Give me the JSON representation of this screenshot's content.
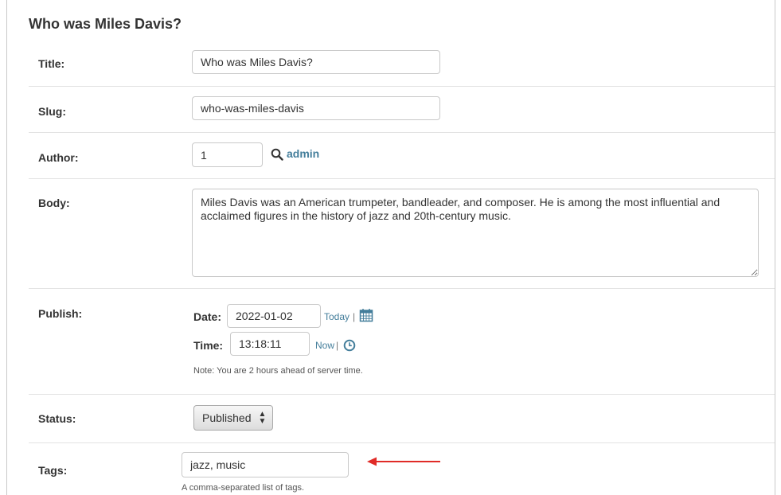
{
  "page": {
    "title": "Who was Miles Davis?"
  },
  "fields": {
    "title": {
      "label": "Title:",
      "value": "Who was Miles Davis?"
    },
    "slug": {
      "label": "Slug:",
      "value": "who-was-miles-davis"
    },
    "author": {
      "label": "Author:",
      "value": "1",
      "lookup_name": "admin",
      "icon": "search-icon"
    },
    "body": {
      "label": "Body:",
      "value": "Miles Davis was an American trumpeter, bandleader, and composer. He is among the most influential and acclaimed figures in the history of jazz and 20th-century music."
    },
    "publish": {
      "label": "Publish:",
      "date_label": "Date:",
      "date_value": "2022-01-02",
      "today_link": "Today",
      "date_separator": "|",
      "date_icon": "calendar-icon",
      "time_label": "Time:",
      "time_value": "13:18:11",
      "now_link": "Now",
      "time_separator": "|",
      "time_icon": "clock-icon",
      "note": "Note: You are 2 hours ahead of server time."
    },
    "status": {
      "label": "Status:",
      "value": "Published"
    },
    "tags": {
      "label": "Tags:",
      "value": "jazz, music",
      "help": "A comma-separated list of tags."
    }
  },
  "colors": {
    "link": "#447e9b",
    "annotation_arrow": "#e02b27"
  }
}
